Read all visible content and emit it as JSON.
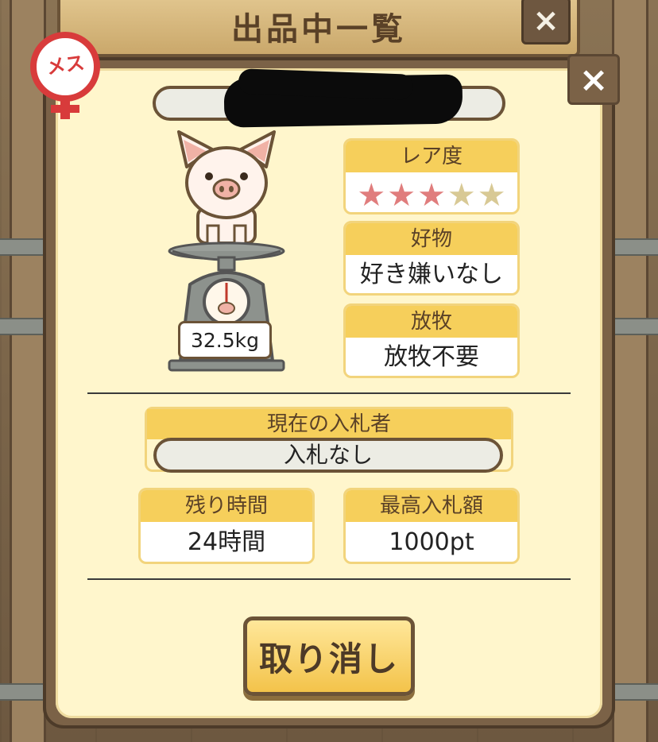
{
  "header": {
    "title": "出品中一覧",
    "close_icon": "×"
  },
  "dialog": {
    "close_icon": "×"
  },
  "pig": {
    "gender_label": "メス",
    "weight": "32.5kg"
  },
  "rarity": {
    "label": "レア度",
    "stars_filled": 3,
    "stars_total": 5,
    "star_glyph": "★"
  },
  "favorite_food": {
    "label": "好物",
    "value": "好き嫌いなし"
  },
  "grazing": {
    "label": "放牧",
    "value": "放牧不要"
  },
  "current_bidder": {
    "label": "現在の入札者",
    "value": "入札なし"
  },
  "time_left": {
    "label": "残り時間",
    "value": "24時間"
  },
  "highest_bid": {
    "label": "最高入札額",
    "value": "1000pt"
  },
  "actions": {
    "cancel_label": "取り消し"
  },
  "colors": {
    "panel": "#fff6cc",
    "card_header": "#f6cf5b",
    "star_on": "#e07d7d",
    "star_off": "#d8c995",
    "gender_red": "#d83b3b",
    "frame_brown": "#7b6247"
  }
}
